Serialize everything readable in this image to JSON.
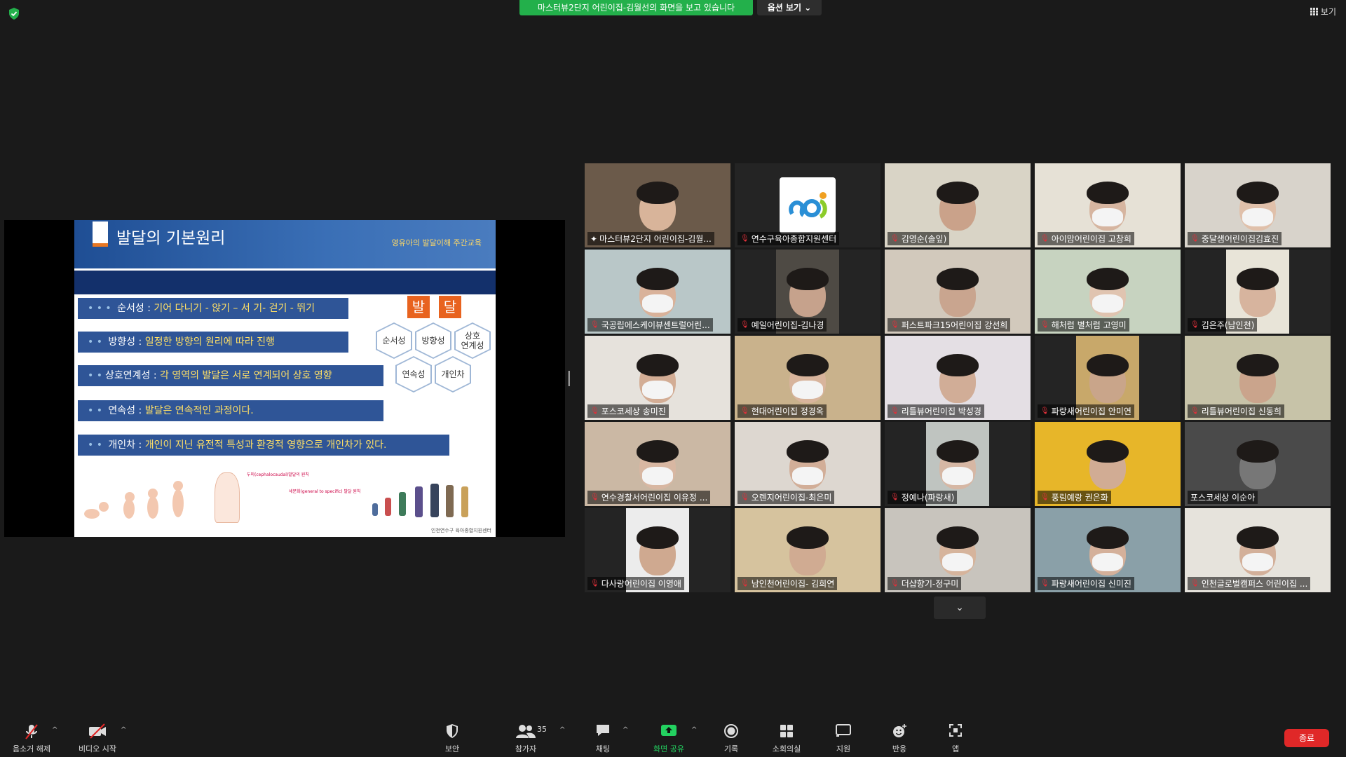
{
  "topbar": {
    "share_banner": "마스터뷰2단지 어린이집-김월선의 화면을 보고 있습니다",
    "view_options": "옵션 보기 ⌄",
    "view_label": "보기"
  },
  "slide": {
    "title": "발달의 기본원리",
    "subtitle": "영유아의 발달이해 주간교육",
    "rows": [
      {
        "term": "순서성 :",
        "desc": "기어 다니기 - 앉기 – 서 기- 걷기 - 뛰기"
      },
      {
        "term": "방향성 :",
        "desc": "일정한 방향의 원리에 따라 진행"
      },
      {
        "term": "상호연계성 :",
        "desc": "각 영역의 발달은 서로 연계되어 상호 영향"
      },
      {
        "term": "연속성 :",
        "desc": "발달은 연속적인 과정이다."
      },
      {
        "term": "개인차 :",
        "desc": "개인이 지닌 유전적 특성과 환경적 영향으로 개인차가 있다."
      }
    ],
    "bal": "발",
    "dal": "달",
    "hex_labels": [
      "순서성",
      "방향성",
      "상호\n연계성",
      "연속성",
      "개인차"
    ],
    "figure_note": "두미(cephalocaudal)발달의 원칙",
    "figure_note2": "세분화(general to specific) 발달 원칙",
    "logo_text": "인천연수구 육아종합지원센터"
  },
  "participants": [
    {
      "name": "마스터뷰2단지 어린이집-김월...",
      "active": true,
      "bg": "#6b5a4a",
      "skin": "#d8b49a",
      "mask": false,
      "muted": false
    },
    {
      "name": "연수구육아종합지원센터",
      "logo": true,
      "muted": true
    },
    {
      "name": "김영순(솔잎)",
      "bg": "#d9d4c6",
      "skin": "#caa28a",
      "mask": false,
      "muted": true
    },
    {
      "name": "아이맘어린이집 고창희",
      "bg": "#e6e1d6",
      "skin": "#d6b5a0",
      "mask": true,
      "muted": true
    },
    {
      "name": "중달샘어린이집김효진",
      "bg": "#d8d3cb",
      "skin": "#e0c0aa",
      "mask": true,
      "muted": true
    },
    {
      "name": "국공립에스케이뷰센트럴어린...",
      "bg": "#b9c7c8",
      "skin": "#d9b29a",
      "mask": true,
      "muted": true
    },
    {
      "name": "예일어린이집-김나경",
      "bg": "#4e4a44",
      "skin": "#c6a28c",
      "mask": false,
      "muted": true
    },
    {
      "name": "퍼스트파크15어린이집 강선희",
      "bg": "#d2c9bc",
      "skin": "#c9a58f",
      "mask": false,
      "muted": true
    },
    {
      "name": "해처럼 별처럼 고영미",
      "bg": "#c7d3c0",
      "skin": "#e0c4b0",
      "mask": true,
      "muted": true
    },
    {
      "name": "김은주(남인천)",
      "bg": "#e8e4d8",
      "skin": "#d7b49e",
      "mask": false,
      "muted": true
    },
    {
      "name": "포스코세상 송미진",
      "bg": "#e6e2dc",
      "skin": "#d3ad95",
      "mask": true,
      "muted": true
    },
    {
      "name": "현대어린이집 정경옥",
      "bg": "#c9b28c",
      "skin": "#d8b49c",
      "mask": true,
      "muted": true
    },
    {
      "name": "리틀뷰어린이집 박성경",
      "bg": "#e4dfe4",
      "skin": "#d1ad97",
      "mask": false,
      "muted": true
    },
    {
      "name": "파랑새어린이집 안미연",
      "bg": "#c8a86a",
      "skin": "#c9a58a",
      "mask": false,
      "muted": true
    },
    {
      "name": "리틀뷰어린이집 신동희",
      "bg": "#c7c3a8",
      "skin": "#caa48c",
      "mask": false,
      "muted": true
    },
    {
      "name": "연수경찰서어린이집 이유정 ...",
      "bg": "#cbb8a4",
      "skin": "#d8b7a2",
      "mask": true,
      "muted": true
    },
    {
      "name": "오렌지어린이집-최은미",
      "bg": "#ddd7d0",
      "skin": "#d2ae98",
      "mask": true,
      "muted": true
    },
    {
      "name": "정예나(파랑새)",
      "bg": "#bfc4c0",
      "skin": "#d6b7a4",
      "mask": true,
      "muted": true
    },
    {
      "name": "풍림예랑 권은화",
      "bg": "#e7b629",
      "skin": "#d1ac94",
      "mask": false,
      "muted": true
    },
    {
      "name": "포스코세상 이순아",
      "bg": "#4a4a4a",
      "skin": "#777",
      "mask": false,
      "muted": false
    },
    {
      "name": "다사랑어린이집 이영애",
      "bg": "#ececec",
      "skin": "#cfa990",
      "mask": false,
      "muted": true
    },
    {
      "name": "남인천어린이집- 김희연",
      "bg": "#d6c39e",
      "skin": "#d0ab92",
      "mask": false,
      "muted": true
    },
    {
      "name": "더샵향기-정구미",
      "bg": "#c8c4bd",
      "skin": "#d6b49c",
      "mask": true,
      "muted": true
    },
    {
      "name": "파랑새어린이집 신미진",
      "bg": "#8aa0a8",
      "skin": "#d4b09a",
      "mask": true,
      "muted": true
    },
    {
      "name": "인천글로벌캠퍼스 어린이집 ...",
      "bg": "#e6e3dc",
      "skin": "#d3b09a",
      "mask": true,
      "muted": true
    }
  ],
  "toolbar": {
    "mute": "음소거 해제",
    "video": "비디오 시작",
    "security": "보안",
    "participants": "참가자",
    "participant_count": "35",
    "chat": "채팅",
    "share": "화면 공유",
    "record": "기록",
    "breakout": "소회의실",
    "support": "지원",
    "reactions": "반응",
    "apps": "앱",
    "end": "종료"
  }
}
